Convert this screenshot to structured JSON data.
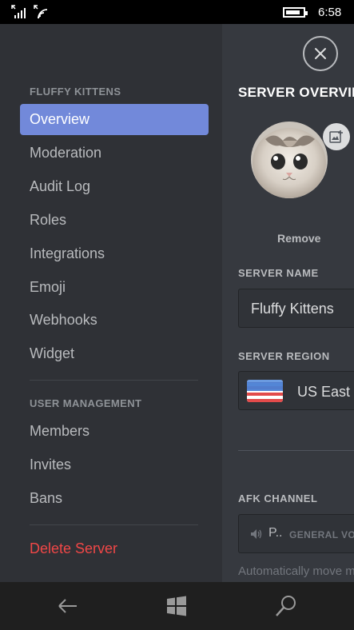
{
  "status_bar": {
    "time": "6:58",
    "battery_level": 0.85,
    "icons": [
      "signal-icon",
      "wifi-icon",
      "battery-icon"
    ]
  },
  "sidebar": {
    "server_header": "FLUFFY KITTENS",
    "items": [
      {
        "label": "Overview",
        "active": true
      },
      {
        "label": "Moderation"
      },
      {
        "label": "Audit Log"
      },
      {
        "label": "Roles"
      },
      {
        "label": "Integrations"
      },
      {
        "label": "Emoji"
      },
      {
        "label": "Webhooks"
      },
      {
        "label": "Widget"
      }
    ],
    "user_management_header": "USER MANAGEMENT",
    "user_items": [
      {
        "label": "Members"
      },
      {
        "label": "Invites"
      },
      {
        "label": "Bans"
      }
    ],
    "delete_label": "Delete Server"
  },
  "main": {
    "title": "SERVER OVERVIEW",
    "avatar_remove": "Remove",
    "server_name_label": "SERVER NAME",
    "server_name_value": "Fluffy Kittens",
    "server_region_label": "SERVER REGION",
    "server_region_value": "US East",
    "afk_channel_label": "AFK CHANNEL",
    "afk_channel_name": "P..",
    "afk_channel_category": "GENERAL VOICE",
    "afk_hint": "Automatically move members"
  },
  "nav_bar": {
    "icons": [
      "back-icon",
      "windows-start-icon",
      "search-icon"
    ]
  },
  "colors": {
    "accent": "#7289da",
    "danger": "#f04747",
    "sidebar_bg": "#2f3136",
    "main_bg": "#36393f"
  }
}
